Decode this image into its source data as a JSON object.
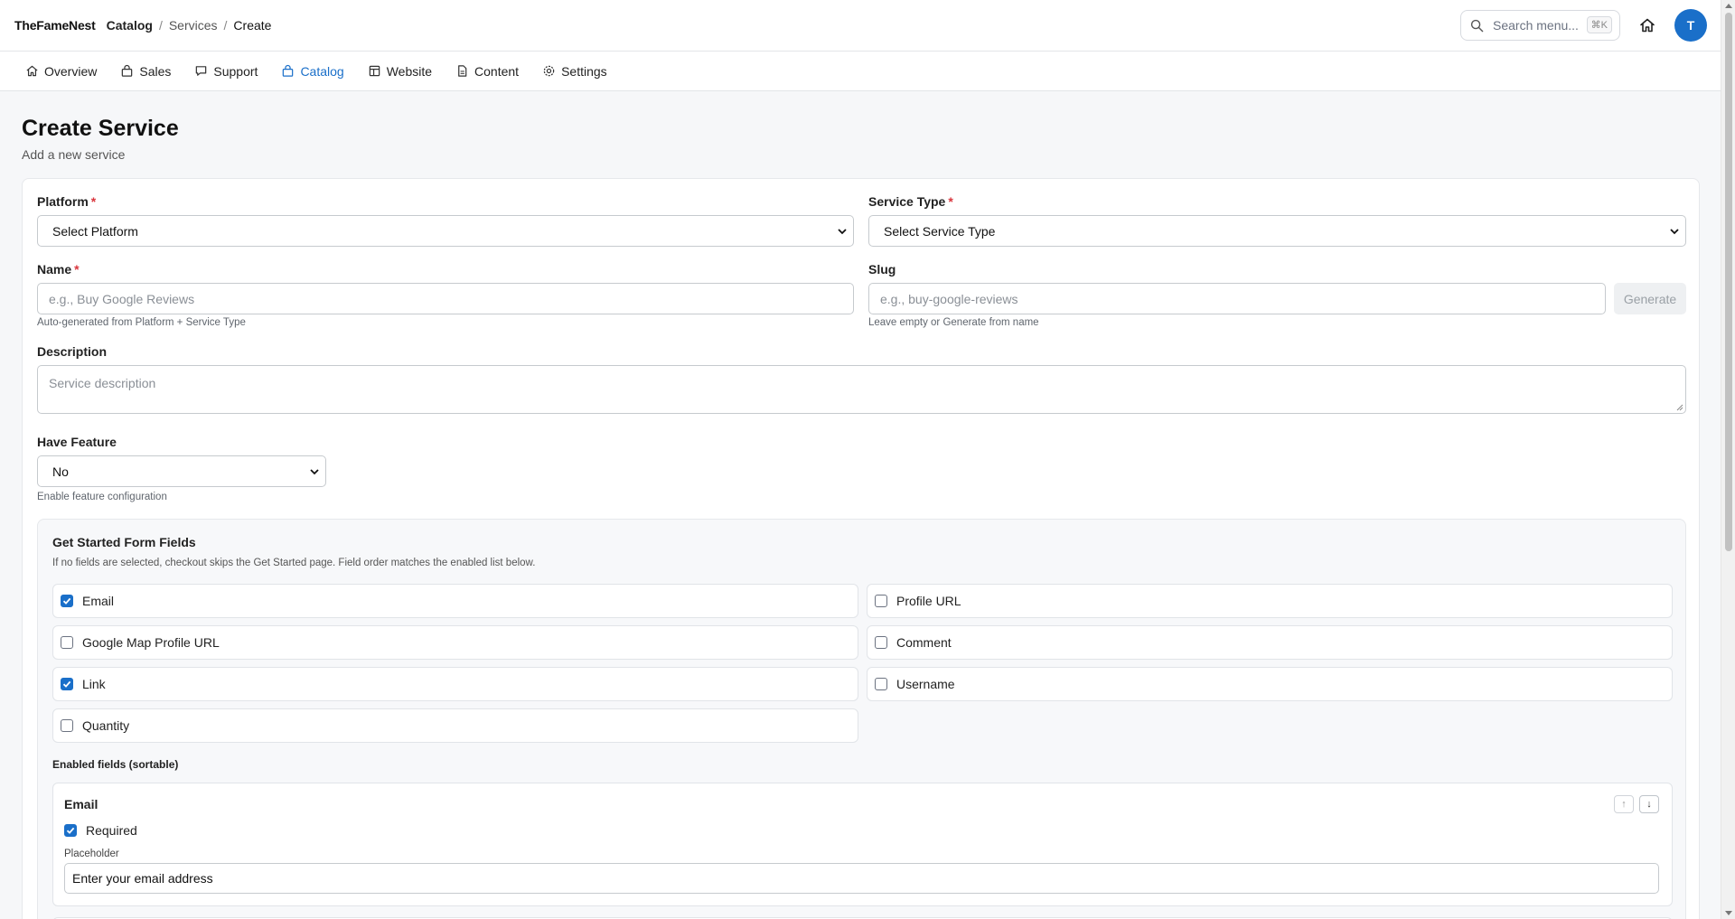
{
  "header": {
    "brand": "TheFameNest",
    "breadcrumb": [
      "Catalog",
      "Services",
      "Create"
    ],
    "search_placeholder": "Search menu...",
    "search_shortcut": "⌘K",
    "avatar_initial": "T"
  },
  "nav": {
    "items": [
      {
        "label": "Overview",
        "icon": "home-icon"
      },
      {
        "label": "Sales",
        "icon": "bag-icon"
      },
      {
        "label": "Support",
        "icon": "chat-icon"
      },
      {
        "label": "Catalog",
        "icon": "bag-icon",
        "active": true
      },
      {
        "label": "Website",
        "icon": "layout-icon"
      },
      {
        "label": "Content",
        "icon": "document-icon"
      },
      {
        "label": "Settings",
        "icon": "gear-icon"
      }
    ]
  },
  "page": {
    "title": "Create Service",
    "subtitle": "Add a new service"
  },
  "form": {
    "platform": {
      "label": "Platform",
      "required_mark": "*",
      "value": "Select Platform"
    },
    "service_type": {
      "label": "Service Type",
      "required_mark": "*",
      "value": "Select Service Type"
    },
    "name": {
      "label": "Name",
      "required_mark": "*",
      "placeholder": "e.g., Buy Google Reviews",
      "help": "Auto-generated from Platform + Service Type"
    },
    "slug": {
      "label": "Slug",
      "placeholder": "e.g., buy-google-reviews",
      "help": "Leave empty or Generate from name",
      "generate_label": "Generate"
    },
    "description": {
      "label": "Description",
      "placeholder": "Service description"
    },
    "have_feature": {
      "label": "Have Feature",
      "value": "No",
      "help": "Enable feature configuration"
    }
  },
  "get_started": {
    "title": "Get Started Form Fields",
    "description": "If no fields are selected, checkout skips the Get Started page. Field order matches the enabled list below.",
    "options": [
      {
        "label": "Email",
        "checked": true
      },
      {
        "label": "Profile URL",
        "checked": false
      },
      {
        "label": "Google Map Profile URL",
        "checked": false
      },
      {
        "label": "Comment",
        "checked": false
      },
      {
        "label": "Link",
        "checked": true
      },
      {
        "label": "Username",
        "checked": false
      },
      {
        "label": "Quantity",
        "checked": false
      }
    ],
    "enabled_label": "Enabled fields (sortable)",
    "enabled_fields": [
      {
        "title": "Email",
        "required_label": "Required",
        "required": true,
        "placeholder_label": "Placeholder",
        "placeholder_value": "Enter your email address",
        "up": "↑",
        "down": "↓"
      }
    ]
  },
  "colors": {
    "accent": "#1a6fc9",
    "required": "#d9363e",
    "background": "#f6f7f9"
  }
}
